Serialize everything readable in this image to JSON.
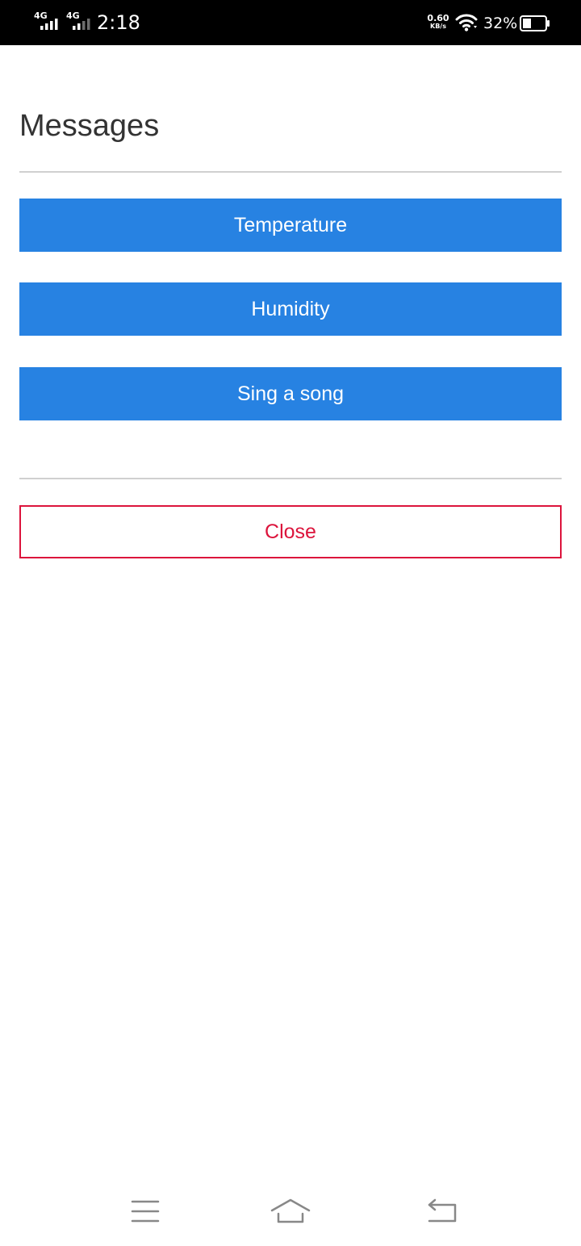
{
  "status_bar": {
    "network_1": "4G",
    "network_2": "4G",
    "time": "2:18",
    "net_speed": "0.60",
    "net_speed_unit": "KB/s",
    "battery_percent": "32%",
    "icons": [
      "signal-icon",
      "wifi-icon",
      "battery-icon"
    ]
  },
  "page": {
    "title": "Messages"
  },
  "messages": [
    {
      "label": "Temperature"
    },
    {
      "label": "Humidity"
    },
    {
      "label": "Sing a song"
    }
  ],
  "close_label": "Close",
  "nav_bar": {
    "icons": [
      "menu-icon",
      "home-icon",
      "back-icon"
    ]
  },
  "colors": {
    "primary_button": "#2782e2",
    "close_accent": "#dc143c",
    "divider": "#d0d0d0",
    "title_text": "#333333",
    "status_bar_bg": "#000000"
  }
}
